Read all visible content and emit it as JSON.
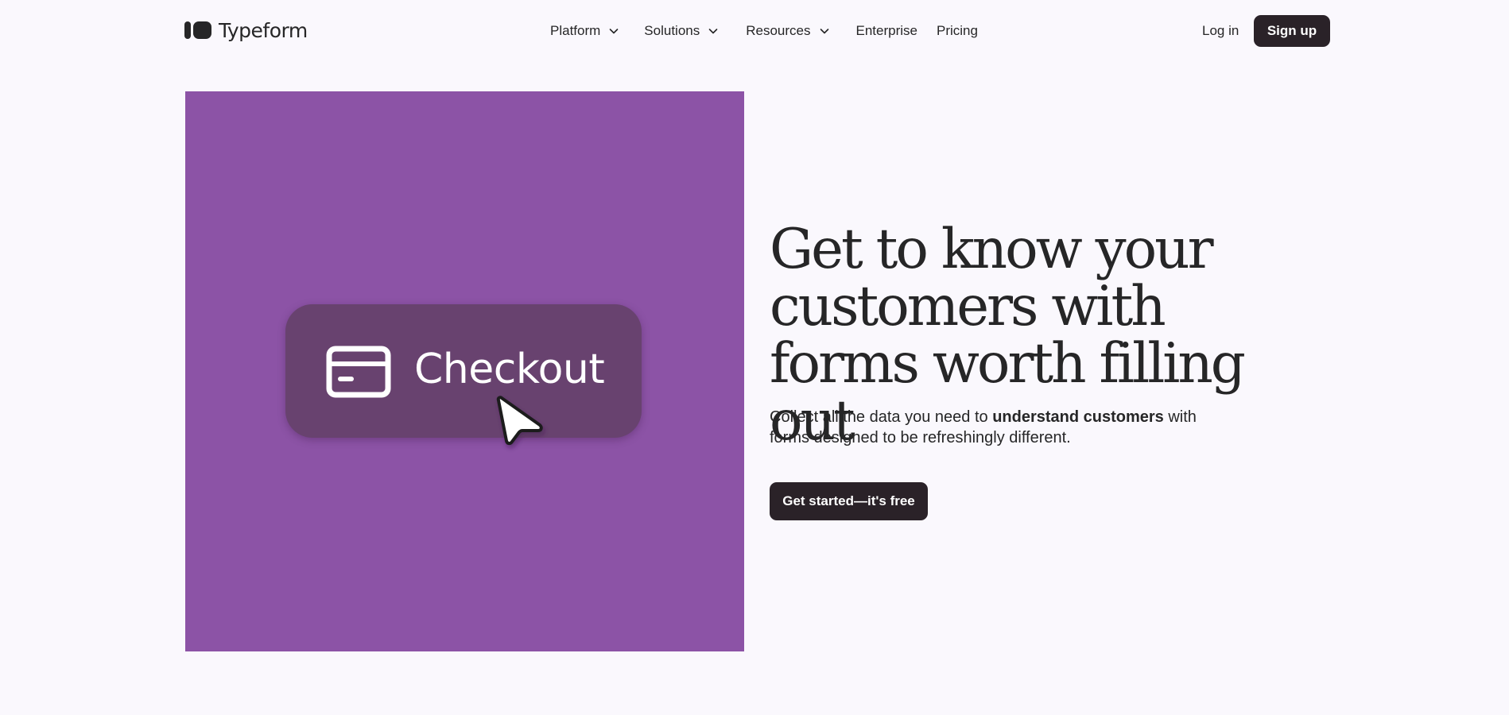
{
  "header": {
    "logo_text": "Typeform",
    "nav": [
      {
        "label": "Platform",
        "has_dropdown": true
      },
      {
        "label": "Solutions",
        "has_dropdown": true
      },
      {
        "label": "Resources",
        "has_dropdown": true
      },
      {
        "label": "Enterprise",
        "has_dropdown": false
      },
      {
        "label": "Pricing",
        "has_dropdown": false
      }
    ],
    "login_label": "Log in",
    "signup_label": "Sign up"
  },
  "hero": {
    "media": {
      "background_color": "#8c53a6",
      "card_label": "Checkout",
      "card_icon": "credit-card-icon",
      "pointer_icon": "cursor-pointer-icon"
    },
    "headline": "Get to know your customers with forms worth filling out",
    "subtext_before": "Collect all the data you need to ",
    "subtext_emphasis": "understand customers",
    "subtext_after": " with forms designed to be refreshingly different.",
    "cta_label": "Get started—it's free"
  },
  "colors": {
    "background": "#faf8fd",
    "text": "#262627",
    "button": "#2a2228",
    "card": "#68426f"
  }
}
